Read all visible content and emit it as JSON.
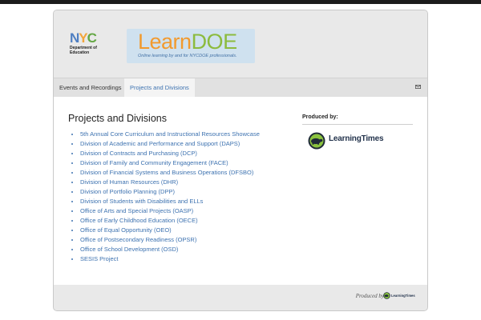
{
  "header": {
    "nyc_letters": [
      "N",
      "Y",
      "C"
    ],
    "nyc_department": [
      "Department of",
      "Education"
    ],
    "learndoe_learn": "Learn",
    "learndoe_doe": "DOE",
    "learndoe_tagline": "Online learning by and for NYCDOE professionals."
  },
  "nav": {
    "tabs": [
      {
        "label": "Events and Recordings"
      },
      {
        "label": "Projects and Divisions"
      }
    ],
    "mail_icon": "envelope-icon"
  },
  "main": {
    "title": "Projects and Divisions",
    "items": [
      "5th Annual Core Curriculum and Instructional Resources Showcase",
      "Division of Academic and Performance and Support (DAPS)",
      "Division of Contracts and Purchasing (DCP)",
      "Division of Family and Community Engagement (FACE)",
      "Division of Financial Systems and Business Operations (DFSBO)",
      "Division of Human Resources (DHR)",
      "Division of Portfolio Planning (DPP)",
      "Division of Students with Disabilities and ELLs",
      "Office of Arts and Special Projects (OASP)",
      "Office of Early Childhood Education (OECE)",
      "Office of Equal Opportunity (OEO)",
      "Office of Postsecondary Readiness (OPSR)",
      "Office of School Development (OSD)",
      "SESIS Project"
    ]
  },
  "sidebar": {
    "produced_by": "Produced by:",
    "logo_text": "LearningTimes"
  },
  "footer": {
    "produced_by": "Produced by",
    "logo_text": "LearningTimes"
  },
  "colors": {
    "link": "#3d72b0",
    "learn_orange": "#f29a2e",
    "doe_green": "#8cbb3e",
    "frame_bg": "#e9e9e9"
  }
}
